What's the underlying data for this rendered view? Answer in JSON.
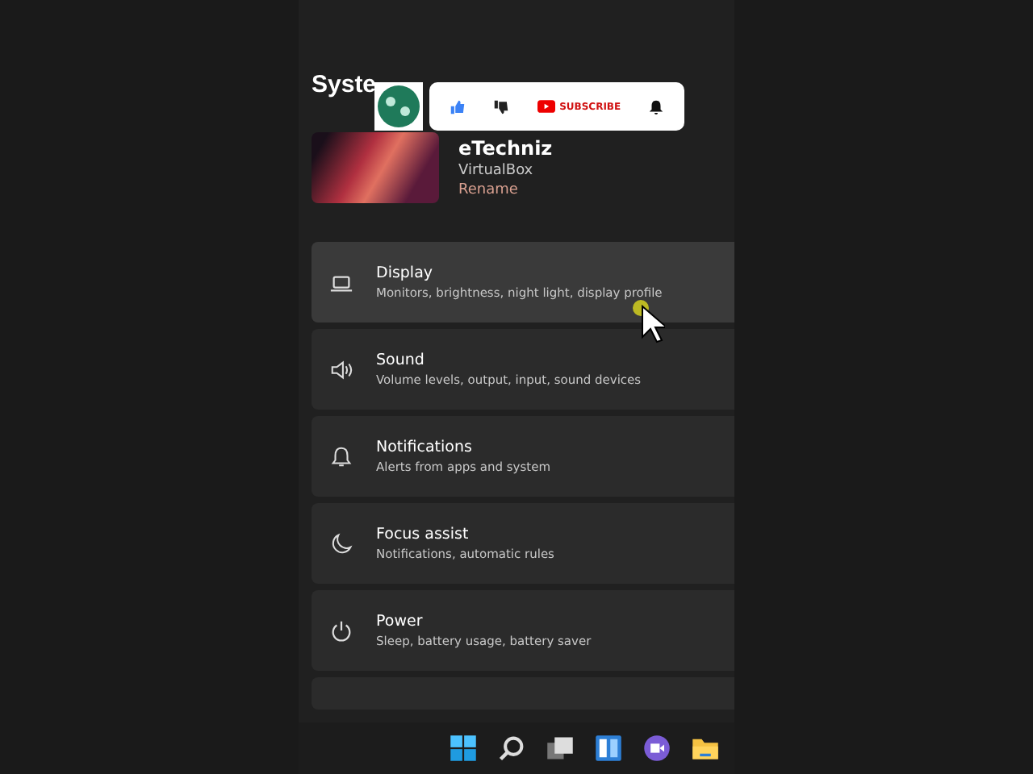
{
  "page": {
    "title": "Syste"
  },
  "profile": {
    "name": "eTechniz",
    "subtitle": "VirtualBox",
    "link": "Rename"
  },
  "settings": [
    {
      "kind": "display",
      "title": "Display",
      "description": "Monitors, brightness, night light, display profile",
      "highlighted": true
    },
    {
      "kind": "sound",
      "title": "Sound",
      "description": "Volume levels, output, input, sound devices",
      "highlighted": false
    },
    {
      "kind": "notifications",
      "title": "Notifications",
      "description": "Alerts from apps and system",
      "highlighted": false
    },
    {
      "kind": "focus",
      "title": "Focus assist",
      "description": "Notifications, automatic rules",
      "highlighted": false
    },
    {
      "kind": "power",
      "title": "Power",
      "description": "Sleep, battery usage, battery saver",
      "highlighted": false
    }
  ],
  "overlay": {
    "subscribe": "SUBSCRIBE"
  },
  "taskbar": [
    {
      "kind": "start"
    },
    {
      "kind": "search"
    },
    {
      "kind": "taskview"
    },
    {
      "kind": "widgets"
    },
    {
      "kind": "chat"
    },
    {
      "kind": "explorer"
    }
  ]
}
